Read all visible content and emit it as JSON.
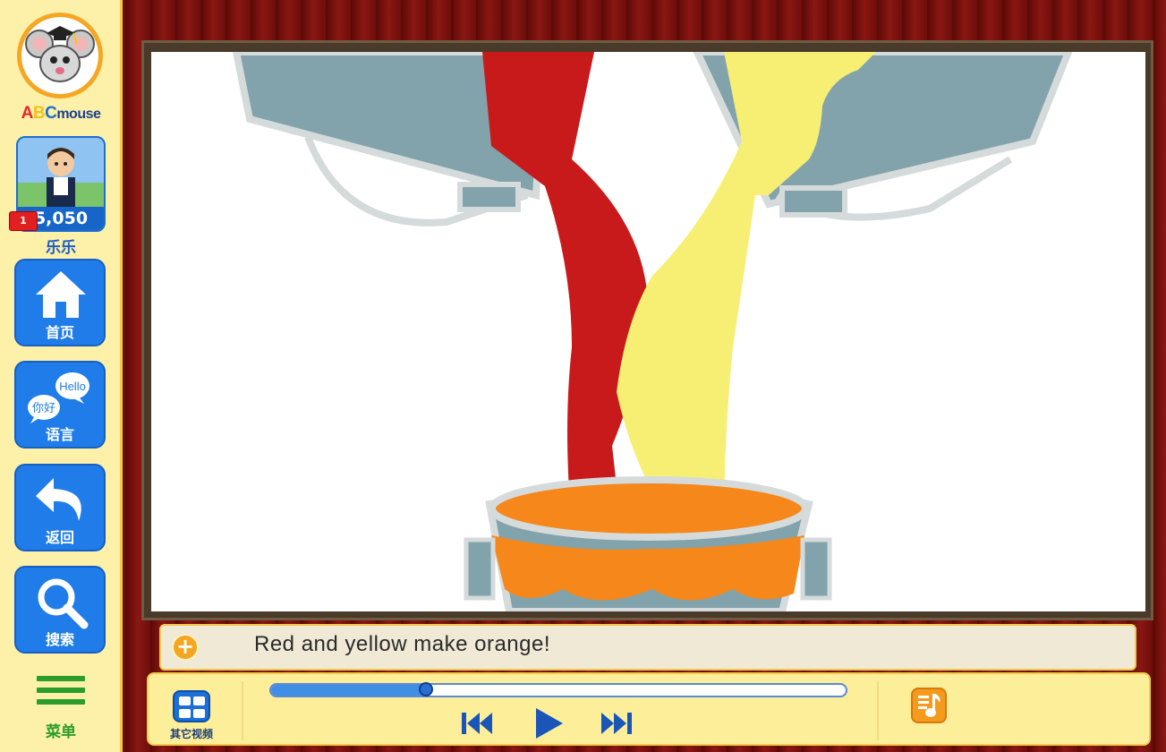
{
  "sidebar": {
    "logo": {
      "brand": "ABCmouse",
      "letters": [
        "A",
        "B",
        "C",
        "mouse"
      ]
    },
    "avatar": {
      "points": "5,050",
      "badge": "1",
      "name": "乐乐"
    },
    "nav": [
      {
        "label": "首页",
        "icon": "home-icon"
      },
      {
        "label": "语言",
        "icon": "speech-bubbles-icon",
        "bubble_en": "Hello",
        "bubble_zh": "你好"
      },
      {
        "label": "返回",
        "icon": "back-arrow-icon"
      },
      {
        "label": "搜索",
        "icon": "search-icon"
      }
    ],
    "menu": {
      "label": "菜单",
      "icon": "hamburger-menu-icon"
    }
  },
  "video": {
    "caption": "Red and yellow make orange!",
    "progress": 0.27
  },
  "controls": {
    "other_videos_label": "其它视频",
    "icons": [
      "grid-icon",
      "previous-track-icon",
      "play-icon",
      "next-track-icon",
      "music-note-icon"
    ]
  },
  "colors": {
    "red_paint": "#c81a1a",
    "yellow_paint": "#f7ef73",
    "orange_paint": "#f6871a",
    "bucket": "#82a3ab",
    "nav_blue": "#1f7ce8",
    "sidebar_bg": "#fdf0a8"
  }
}
